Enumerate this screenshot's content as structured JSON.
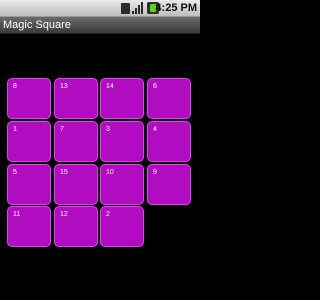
{
  "status_bar": {
    "time": "4:25 PM",
    "icons": [
      "sim-card-icon",
      "signal-icon",
      "battery-charging-icon"
    ]
  },
  "app": {
    "title": "Magic Square"
  },
  "board": {
    "rows": 4,
    "columns": 4,
    "tiles": [
      [
        "8",
        "13",
        "14",
        "6"
      ],
      [
        "1",
        "7",
        "3",
        "4"
      ],
      [
        "5",
        "15",
        "10",
        "9"
      ],
      [
        "11",
        "12",
        "2",
        ""
      ]
    ]
  },
  "colors": {
    "tile": "#b20cc2",
    "tile_border": "#d34bde",
    "background": "#000000"
  }
}
